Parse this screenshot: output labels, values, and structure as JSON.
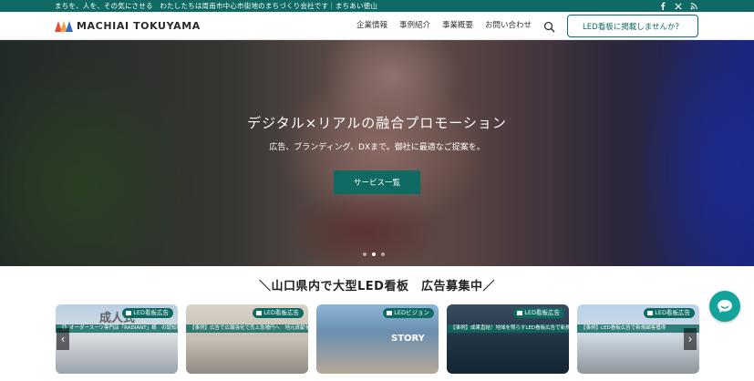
{
  "topbar": {
    "message": "まちを、人を、その気にさせる　わたしたちは周南市中心市街地のまちづくり会社です｜まちあい徳山",
    "social": [
      "facebook-icon",
      "x-icon",
      "rss-icon"
    ]
  },
  "header": {
    "logo_text": "MACHIAI TOKUYAMA",
    "nav": [
      "企業情報",
      "事例紹介",
      "事業概要",
      "お問い合わせ"
    ],
    "cta_label": "LED看板に掲載しませんか？"
  },
  "hero": {
    "title": "デジタル×リアルの融合プロモーション",
    "subtitle": "広告、ブランディング、DXまで。御社に最適なご提案を。",
    "button_label": "サービス一覧",
    "slides_total": 3,
    "slide_active": 2
  },
  "section": {
    "title": "＼山口県内で大型LED看板　広告募集中／"
  },
  "cards": [
    {
      "badge": "LED看板広告",
      "caption": "【】オーダースーツ専門店「RADIANT」様　の認知拡大、成人式スーツのPRにも展開",
      "overlay": "成人式"
    },
    {
      "badge": "LED看板広告",
      "caption": "【事例】広告で広報強化で売上急増円へ　地元貢献を大切にしたLEDビジョンを3年間継続する理由",
      "overlay": ""
    },
    {
      "badge": "LEDビジョン",
      "caption": "",
      "overlay": "STORY"
    },
    {
      "badge": "LED看板広告",
      "caption": "【事例】成果直結！地域を照らすLED看板広告で新規顧客・売上を獲得した秘訣とは？",
      "overlay": ""
    },
    {
      "badge": "LED看板広告",
      "caption": "【事例】LED看板広告で新規顧客獲得",
      "overlay": ""
    }
  ],
  "colors": {
    "brand": "#0e6a62",
    "chat": "#14a39a"
  }
}
